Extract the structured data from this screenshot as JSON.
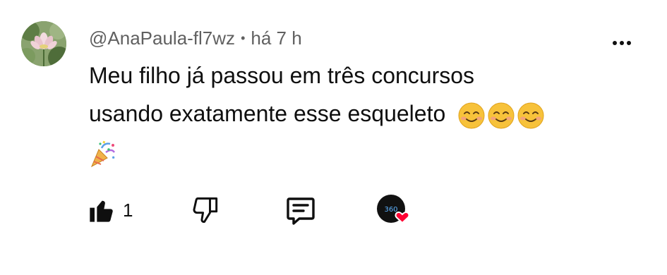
{
  "comment": {
    "author": "@AnaPaula-fl7wz",
    "separator": "•",
    "time": "há 7 h",
    "text_line1": "Meu filho já passou em três concursos",
    "text_line2": "usando exatamente esse esqueleto",
    "emojis_line2": [
      "smiling-face-icon",
      "smiling-face-icon",
      "smiling-face-icon"
    ],
    "emoji_line3": "party-popper-icon",
    "like_count": "1"
  },
  "icons": {
    "avatar": "lotus-flower-avatar",
    "more": "more-vertical-dots-icon",
    "like": "thumbs-up-filled-icon",
    "dislike": "thumbs-down-outline-icon",
    "reply": "reply-comment-icon",
    "creator_heart": "creator-heart-badge-icon"
  },
  "colors": {
    "text": "#0f0f0f",
    "secondary": "#606060",
    "heart": "#ff0033"
  }
}
